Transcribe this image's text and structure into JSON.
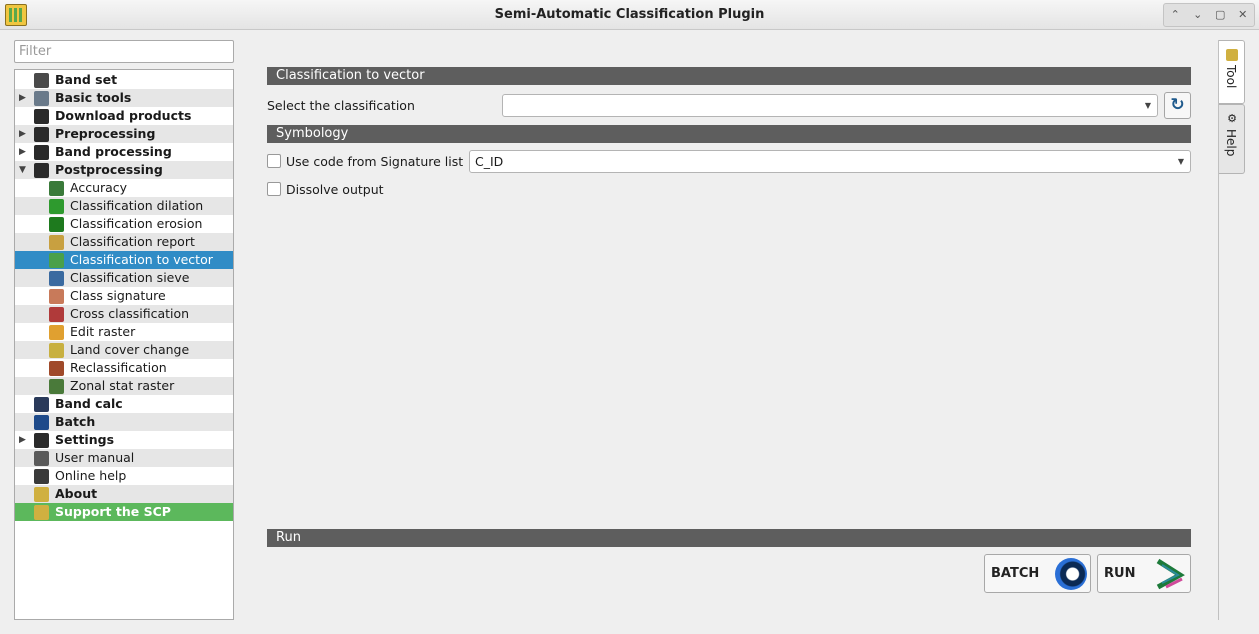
{
  "window": {
    "title": "Semi-Automatic Classification Plugin",
    "controls": [
      "⌃",
      "⌄",
      "▢",
      "✕"
    ]
  },
  "filter": {
    "placeholder": "Filter"
  },
  "tree": {
    "items": [
      {
        "label": "Band set",
        "level": 1,
        "bold": true,
        "arrow": "",
        "icon": "band-set-icon",
        "color": "#4a4a4a"
      },
      {
        "label": "Basic tools",
        "level": 1,
        "bold": true,
        "arrow": "▶",
        "icon": "basic-tools-icon",
        "color": "#6a7a8a"
      },
      {
        "label": "Download products",
        "level": 1,
        "bold": true,
        "arrow": "",
        "icon": "download-icon",
        "color": "#2a2a2a"
      },
      {
        "label": "Preprocessing",
        "level": 1,
        "bold": true,
        "arrow": "▶",
        "icon": "preprocessing-icon",
        "color": "#2a2a2a"
      },
      {
        "label": "Band processing",
        "level": 1,
        "bold": true,
        "arrow": "▶",
        "icon": "band-processing-icon",
        "color": "#2a2a2a"
      },
      {
        "label": "Postprocessing",
        "level": 1,
        "bold": true,
        "arrow": "▼",
        "icon": "postprocessing-icon",
        "color": "#2a2a2a"
      },
      {
        "label": "Accuracy",
        "level": 2,
        "bold": false,
        "arrow": "",
        "icon": "accuracy-icon",
        "color": "#3a7a3a"
      },
      {
        "label": "Classification dilation",
        "level": 2,
        "bold": false,
        "arrow": "",
        "icon": "dilation-icon",
        "color": "#2e9a2e"
      },
      {
        "label": "Classification erosion",
        "level": 2,
        "bold": false,
        "arrow": "",
        "icon": "erosion-icon",
        "color": "#1e7a1e"
      },
      {
        "label": "Classification report",
        "level": 2,
        "bold": false,
        "arrow": "",
        "icon": "report-icon",
        "color": "#c8a040"
      },
      {
        "label": "Classification to vector",
        "level": 2,
        "bold": false,
        "arrow": "",
        "icon": "to-vector-icon",
        "color": "#4aa04a",
        "selected": true
      },
      {
        "label": "Classification sieve",
        "level": 2,
        "bold": false,
        "arrow": "",
        "icon": "sieve-icon",
        "color": "#3a6aa0"
      },
      {
        "label": "Class signature",
        "level": 2,
        "bold": false,
        "arrow": "",
        "icon": "signature-icon",
        "color": "#c87a5a"
      },
      {
        "label": "Cross classification",
        "level": 2,
        "bold": false,
        "arrow": "",
        "icon": "cross-icon",
        "color": "#b03a3a"
      },
      {
        "label": "Edit raster",
        "level": 2,
        "bold": false,
        "arrow": "",
        "icon": "edit-raster-icon",
        "color": "#e0a030"
      },
      {
        "label": "Land cover change",
        "level": 2,
        "bold": false,
        "arrow": "",
        "icon": "land-cover-icon",
        "color": "#c8b040"
      },
      {
        "label": "Reclassification",
        "level": 2,
        "bold": false,
        "arrow": "",
        "icon": "reclass-icon",
        "color": "#a04a2a"
      },
      {
        "label": "Zonal stat raster",
        "level": 2,
        "bold": false,
        "arrow": "",
        "icon": "zonal-icon",
        "color": "#4a7a3a"
      },
      {
        "label": "Band calc",
        "level": 1,
        "bold": true,
        "arrow": "",
        "icon": "band-calc-icon",
        "color": "#2a3a5a"
      },
      {
        "label": "Batch",
        "level": 1,
        "bold": true,
        "arrow": "",
        "icon": "batch-icon",
        "color": "#1e4a8a"
      },
      {
        "label": "Settings",
        "level": 1,
        "bold": true,
        "arrow": "▶",
        "icon": "settings-icon",
        "color": "#2a2a2a"
      },
      {
        "label": "User manual",
        "level": 1,
        "bold": false,
        "arrow": "",
        "icon": "manual-icon",
        "color": "#5a5a5a"
      },
      {
        "label": "Online help",
        "level": 1,
        "bold": false,
        "arrow": "",
        "icon": "help-icon",
        "color": "#3a3a3a"
      },
      {
        "label": "About",
        "level": 1,
        "bold": true,
        "arrow": "",
        "icon": "about-icon",
        "color": "#d0b040"
      },
      {
        "label": "Support the SCP",
        "level": 1,
        "bold": true,
        "arrow": "",
        "icon": "support-icon",
        "color": "#d0b040",
        "support": true
      }
    ]
  },
  "main": {
    "section_title": "Classification to vector",
    "select_label": "Select the classification",
    "select_value": "",
    "symbology_title": "Symbology",
    "use_code_label": "Use code from Signature list",
    "code_value": "C_ID",
    "dissolve_label": "Dissolve output",
    "run_title": "Run",
    "batch_label": "BATCH",
    "run_label": "RUN"
  },
  "tabs": [
    {
      "label": "Tool",
      "icon": "tool-icon"
    },
    {
      "label": "Help",
      "icon": "help-tab-icon"
    }
  ]
}
